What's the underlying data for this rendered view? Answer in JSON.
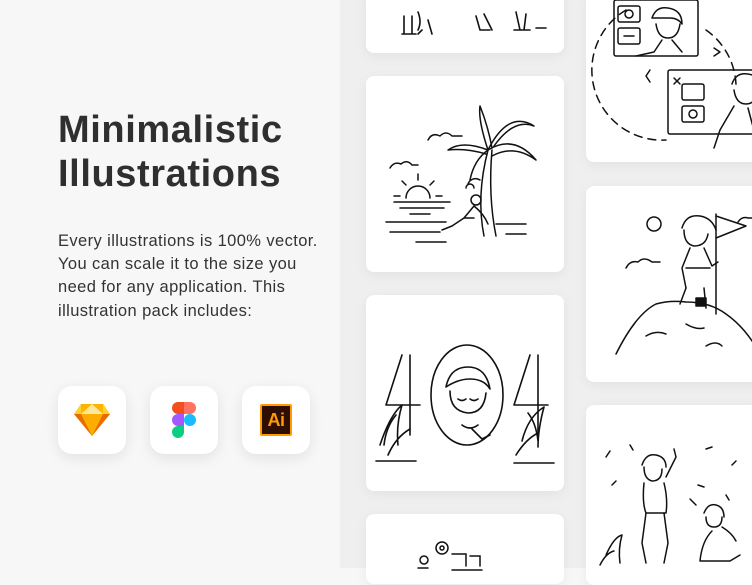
{
  "hero": {
    "title_line1": "Minimalistic",
    "title_line2": "Illustrations",
    "description": "Every illustrations is 100% vector. You can scale it to the size you need for any application. This illustration pack includes:"
  },
  "apps": [
    {
      "name": "Sketch",
      "icon": "sketch-icon"
    },
    {
      "name": "Figma",
      "icon": "figma-icon"
    },
    {
      "name": "Adobe Illustrator",
      "icon": "illustrator-icon",
      "label": "Ai"
    }
  ],
  "colors": {
    "background": "#f7f7f7",
    "panel": "#efefef",
    "card": "#ffffff",
    "title": "#2f2f2f",
    "sketch_orange": "#f7b500",
    "ai_orange": "#ff9a00",
    "ai_dark": "#2e0e00"
  }
}
